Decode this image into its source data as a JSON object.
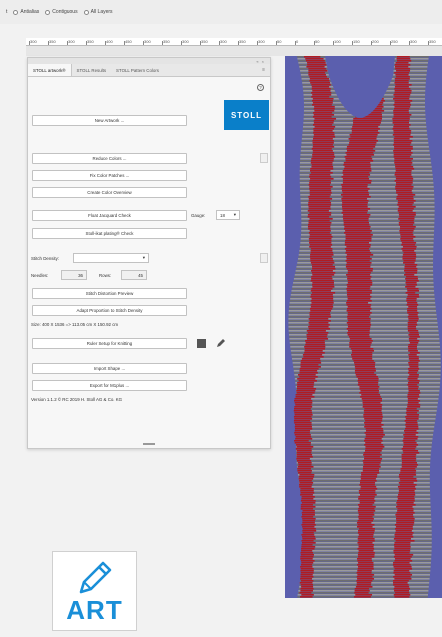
{
  "options_bar": {
    "first_label": "t",
    "options": [
      {
        "label": "Antialias"
      },
      {
        "label": "Contiguous"
      },
      {
        "label": "All Layers"
      }
    ]
  },
  "ruler": {
    "ticks": [
      "300",
      "350",
      "300",
      "350",
      "400",
      "450",
      "300",
      "350",
      "300",
      "350",
      "300",
      "350",
      "300",
      "50",
      "0",
      "50",
      "100",
      "150",
      "200",
      "250",
      "300",
      "350"
    ]
  },
  "panel": {
    "tabs": [
      "STOLL artwork®",
      "STOLL Results",
      "STOLL Pattern Colors"
    ],
    "new_artwork": "New Artwork ...",
    "logo_text": "STOLL",
    "reduce_colors": "Reduce Colors ...",
    "fix_color_patches": "Fix Color Patches ...",
    "create_color_overview": "Create Color Overview",
    "float_jacquard_check": "Float Jacquard Check",
    "gauge_label": "Gauge:",
    "gauge_value": "18",
    "stoll_ikat_check": "Stoll-ikat plating® Check",
    "stitch_density_label": "Stitch Density:",
    "needles_label": "Needles:",
    "needles_value": "36",
    "rows_label": "Rows:",
    "rows_value": "45",
    "stitch_distortion_preview": "Stitch Distortion Preview",
    "adapt_proportion": "Adapt Proportion to Stitch Density",
    "size_text": "Size: 400 X 1536 => 113.05 cm X 150.92 cm",
    "ruler_setup": "Ruler Setup for Knitting",
    "import_shape": "Import Shape ...",
    "export_mcplus": "Export for M1plus ...",
    "version": "Version 1.1.2 © RC 2019 H. Stoll AG & Co. KG"
  },
  "badge": {
    "text": "ART"
  },
  "colors": {
    "blue_bg": "#5b5fae",
    "red": "#b01c22",
    "gray": "#8a8a8a",
    "accent": "#0a7fc9"
  }
}
